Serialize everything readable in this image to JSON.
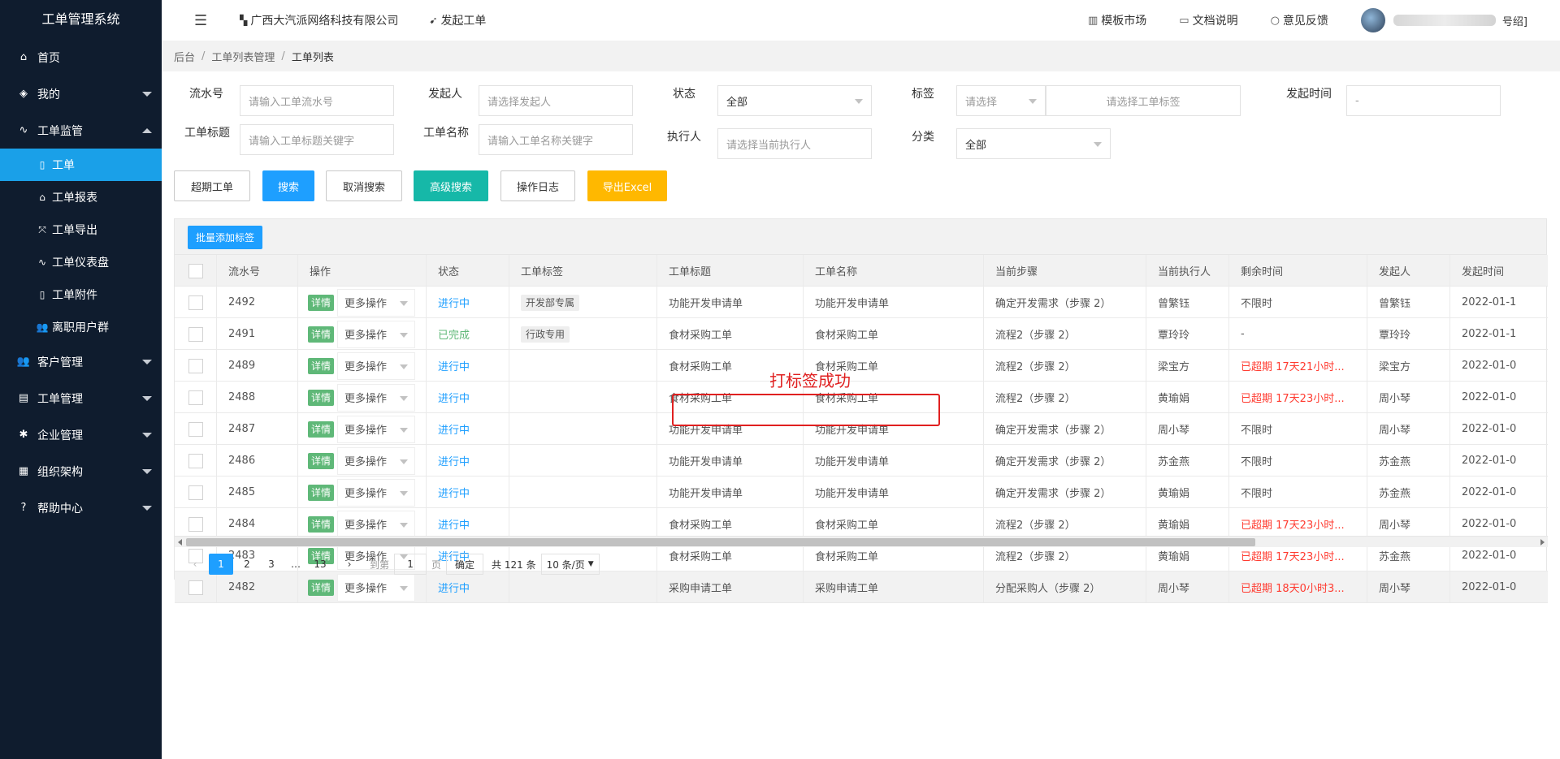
{
  "app_title": "工单管理系统",
  "sidebar": {
    "items": [
      {
        "label": "首页",
        "icon": "home-icon"
      },
      {
        "label": "我的",
        "icon": "layers-icon"
      },
      {
        "label": "工单监管",
        "icon": "pulse-icon"
      },
      {
        "label": "客户管理",
        "icon": "users-icon"
      },
      {
        "label": "工单管理",
        "icon": "clipboard-icon"
      },
      {
        "label": "企业管理",
        "icon": "gear-icon"
      },
      {
        "label": "组织架构",
        "icon": "calendar-icon"
      },
      {
        "label": "帮助中心",
        "icon": "question-icon"
      }
    ],
    "subitems": [
      {
        "label": "工单",
        "icon": "file-icon"
      },
      {
        "label": "工单报表",
        "icon": "home-icon"
      },
      {
        "label": "工单导出",
        "icon": "export-icon"
      },
      {
        "label": "工单仪表盘",
        "icon": "pulse-icon"
      },
      {
        "label": "工单附件",
        "icon": "file-icon"
      },
      {
        "label": "离职用户群",
        "icon": "users-icon"
      }
    ]
  },
  "topbar": {
    "company": "广西大汽派网络科技有限公司",
    "launch": "发起工单",
    "template_market": "模板市场",
    "docs": "文档说明",
    "feedback": "意见反馈",
    "user_tail": "号绍]"
  },
  "breadcrumb": [
    "后台",
    "工单列表管理",
    "工单列表"
  ],
  "filters": {
    "serial_label": "流水号",
    "serial_ph": "请输入工单流水号",
    "initiator_label": "发起人",
    "initiator_ph": "请选择发起人",
    "status_label": "状态",
    "status_val": "全部",
    "tag_label": "标签",
    "tag_select_ph": "请选择",
    "tag_input_ph": "请选择工单标签",
    "time_label": "发起时间",
    "time_val": "-",
    "title_label": "工单标题",
    "title_ph": "请输入工单标题关键字",
    "name_label": "工单名称",
    "name_ph": "请输入工单名称关键字",
    "executor_label": "执行人",
    "executor_ph": "请选择当前执行人",
    "category_label": "分类",
    "category_val": "全部"
  },
  "buttons": {
    "overdue": "超期工单",
    "search": "搜索",
    "cancel": "取消搜索",
    "advanced": "高级搜索",
    "log": "操作日志",
    "export": "导出Excel",
    "batch_tag": "批量添加标签"
  },
  "table": {
    "headers": [
      "流水号",
      "操作",
      "状态",
      "工单标签",
      "工单标题",
      "工单名称",
      "当前步骤",
      "当前执行人",
      "剩余时间",
      "发起人",
      "发起时间"
    ],
    "detail_label": "详情",
    "more_label": "更多操作",
    "rows": [
      {
        "id": "2492",
        "status": "进行中",
        "done": false,
        "tag": "开发部专属",
        "title": "功能开发申请单",
        "name": "功能开发申请单",
        "step": "确定开发需求（步骤 2）",
        "executor": "曾繁钰",
        "remaining": "不限时",
        "overdue": false,
        "initiator": "曾繁钰",
        "time": "2022-01-1"
      },
      {
        "id": "2491",
        "status": "已完成",
        "done": true,
        "tag": "行政专用",
        "title": "食材采购工单",
        "name": "食材采购工单",
        "step": "流程2（步骤 2）",
        "executor": "覃玲玲",
        "remaining": "-",
        "overdue": false,
        "initiator": "覃玲玲",
        "time": "2022-01-1"
      },
      {
        "id": "2489",
        "status": "进行中",
        "done": false,
        "tag": "",
        "title": "食材采购工单",
        "name": "食材采购工单",
        "step": "流程2（步骤 2）",
        "executor": "梁宝方",
        "remaining": "已超期 17天21小时...",
        "overdue": true,
        "initiator": "梁宝方",
        "time": "2022-01-0"
      },
      {
        "id": "2488",
        "status": "进行中",
        "done": false,
        "tag": "",
        "title": "食材采购工单",
        "name": "食材采购工单",
        "step": "流程2（步骤 2）",
        "executor": "黄瑜娟",
        "remaining": "已超期 17天23小时...",
        "overdue": true,
        "initiator": "周小琴",
        "time": "2022-01-0"
      },
      {
        "id": "2487",
        "status": "进行中",
        "done": false,
        "tag": "",
        "title": "功能开发申请单",
        "name": "功能开发申请单",
        "step": "确定开发需求（步骤 2）",
        "executor": "周小琴",
        "remaining": "不限时",
        "overdue": false,
        "initiator": "周小琴",
        "time": "2022-01-0"
      },
      {
        "id": "2486",
        "status": "进行中",
        "done": false,
        "tag": "",
        "title": "功能开发申请单",
        "name": "功能开发申请单",
        "step": "确定开发需求（步骤 2）",
        "executor": "苏金燕",
        "remaining": "不限时",
        "overdue": false,
        "initiator": "苏金燕",
        "time": "2022-01-0"
      },
      {
        "id": "2485",
        "status": "进行中",
        "done": false,
        "tag": "",
        "title": "功能开发申请单",
        "name": "功能开发申请单",
        "step": "确定开发需求（步骤 2）",
        "executor": "黄瑜娟",
        "remaining": "不限时",
        "overdue": false,
        "initiator": "苏金燕",
        "time": "2022-01-0"
      },
      {
        "id": "2484",
        "status": "进行中",
        "done": false,
        "tag": "",
        "title": "食材采购工单",
        "name": "食材采购工单",
        "step": "流程2（步骤 2）",
        "executor": "黄瑜娟",
        "remaining": "已超期 17天23小时...",
        "overdue": true,
        "initiator": "周小琴",
        "time": "2022-01-0"
      },
      {
        "id": "2483",
        "status": "进行中",
        "done": false,
        "tag": "",
        "title": "食材采购工单",
        "name": "食材采购工单",
        "step": "流程2（步骤 2）",
        "executor": "黄瑜娟",
        "remaining": "已超期 17天23小时...",
        "overdue": true,
        "initiator": "苏金燕",
        "time": "2022-01-0"
      },
      {
        "id": "2482",
        "status": "进行中",
        "done": false,
        "tag": "",
        "title": "采购申请工单",
        "name": "采购申请工单",
        "step": "分配采购人（步骤 2）",
        "executor": "周小琴",
        "remaining": "已超期 18天0小时3...",
        "overdue": true,
        "initiator": "周小琴",
        "time": "2022-01-0"
      }
    ]
  },
  "annotation": "打标签成功",
  "pager": {
    "pages": [
      "1",
      "2",
      "3",
      "…",
      "13"
    ],
    "goto_label": "到第",
    "goto_val": "1",
    "page_unit": "页",
    "confirm": "确定",
    "total": "共 121 条",
    "page_size": "10 条/页"
  },
  "colors": {
    "sidebar": "#0f1c2e",
    "accent": "#1e9fff",
    "green": "#5fb878",
    "teal": "#16b8a8",
    "orange": "#ffb800",
    "danger": "#ff3b30"
  }
}
